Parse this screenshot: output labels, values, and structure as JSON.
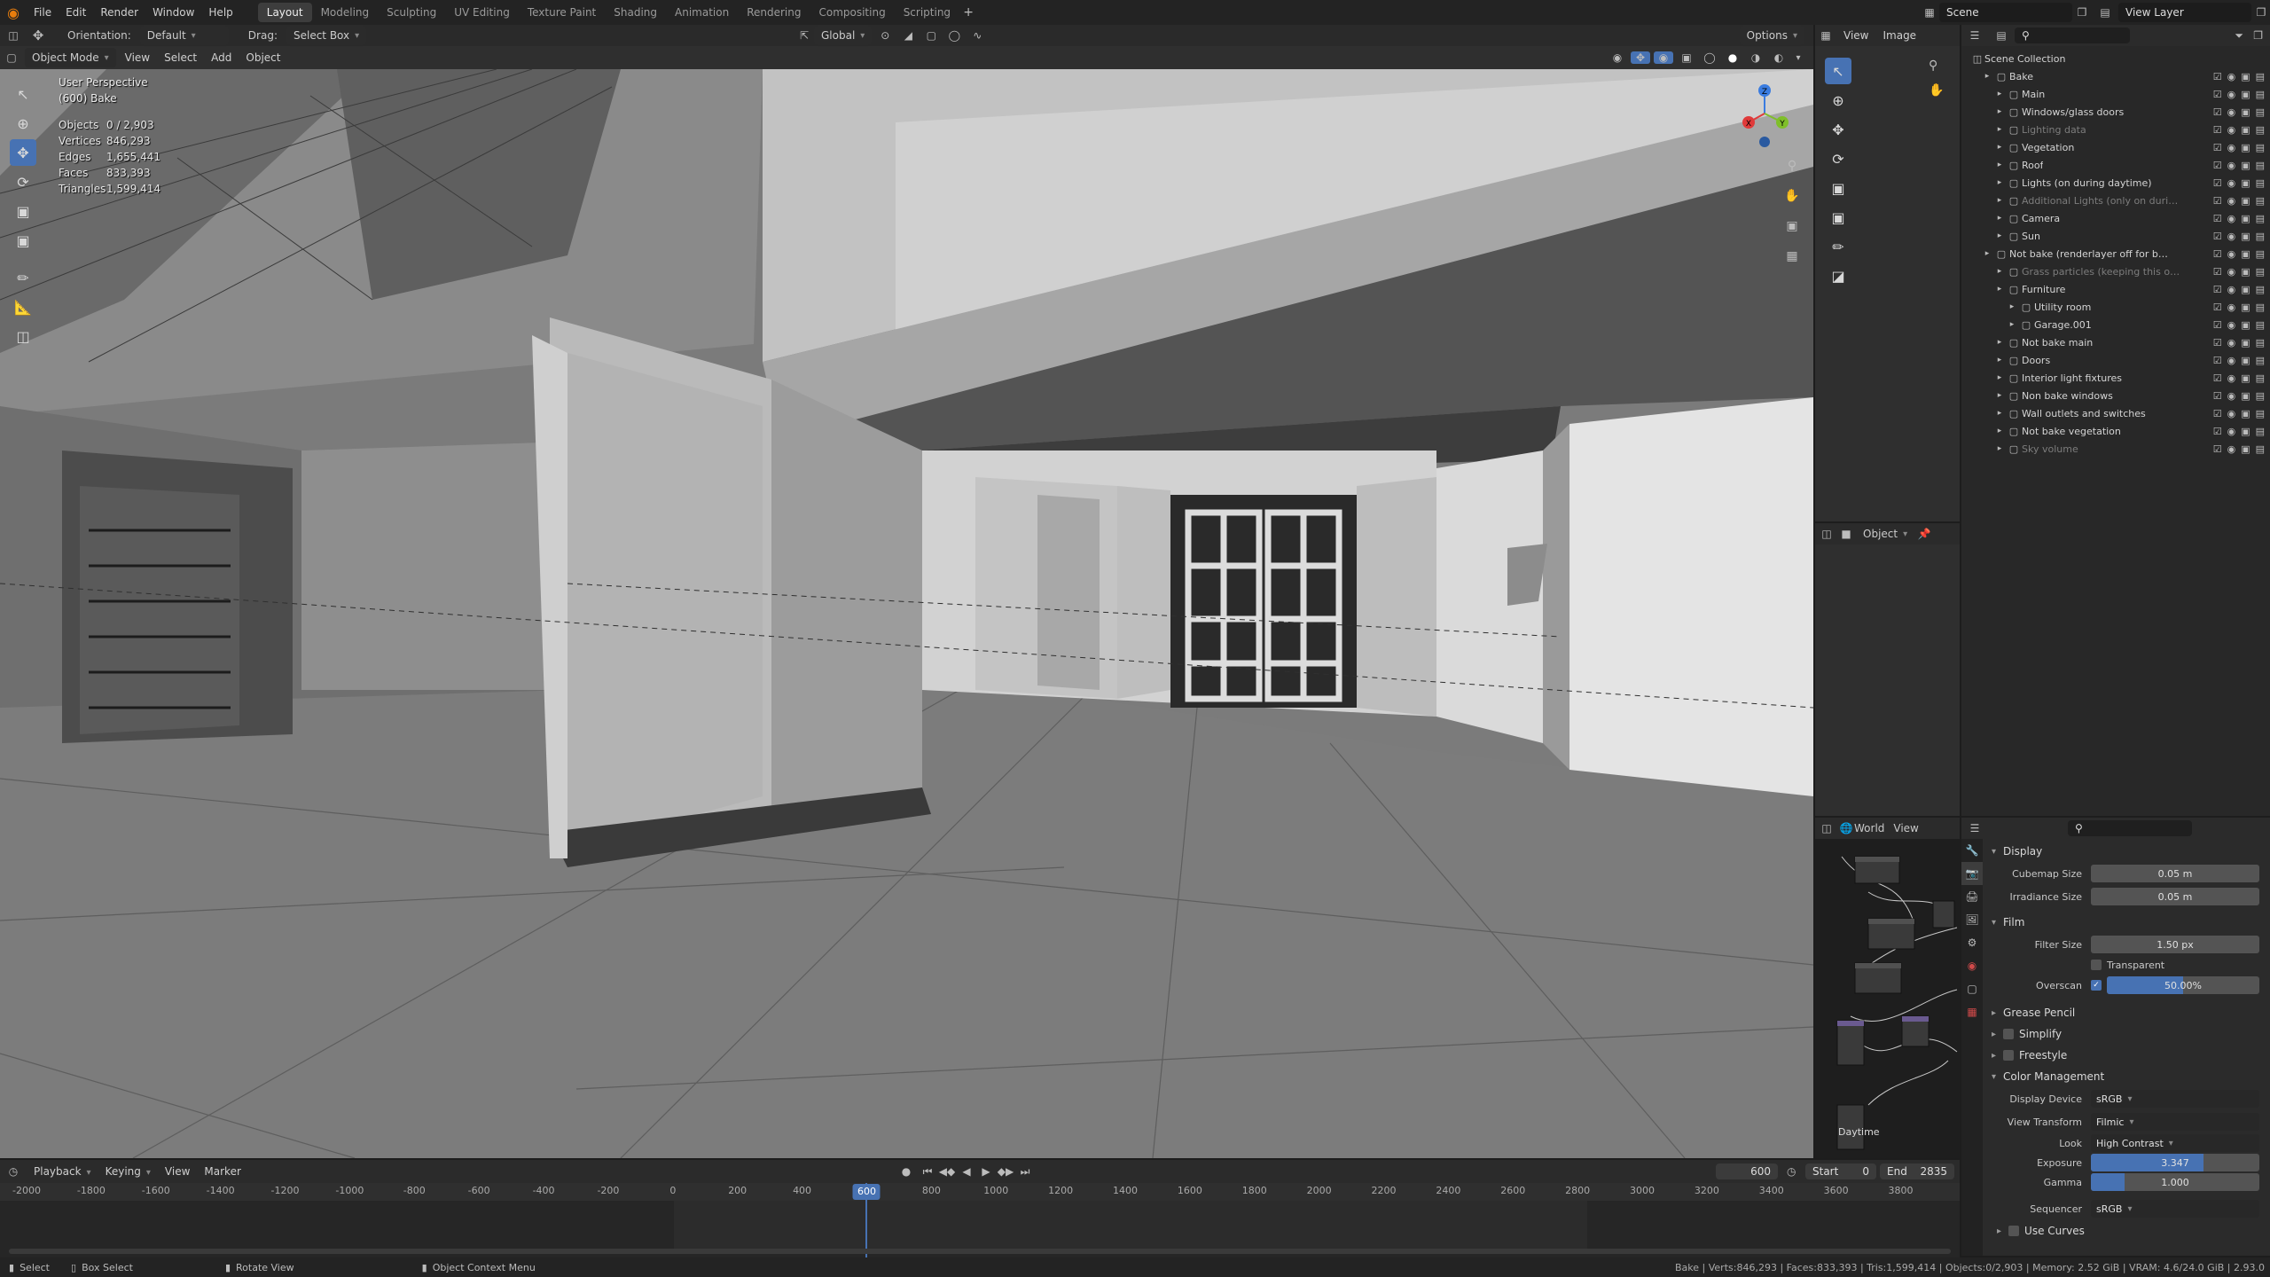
{
  "topbar": {
    "menus": [
      "File",
      "Edit",
      "Render",
      "Window",
      "Help"
    ],
    "workspaces": [
      "Layout",
      "Modeling",
      "Sculpting",
      "UV Editing",
      "Texture Paint",
      "Shading",
      "Animation",
      "Rendering",
      "Compositing",
      "Scripting"
    ],
    "active_workspace": "Layout",
    "scene": "Scene",
    "view_layer": "View Layer"
  },
  "tool_header": {
    "orientation_label": "Orientation:",
    "orientation_value": "Default",
    "drag_label": "Drag:",
    "drag_value": "Select Box",
    "transform_space": "Global",
    "options": "Options"
  },
  "viewport_header": {
    "mode": "Object Mode",
    "menus": [
      "View",
      "Select",
      "Add",
      "Object"
    ]
  },
  "viewport": {
    "view_name": "User Perspective",
    "collection": "(600) Bake",
    "stats": [
      {
        "label": "Objects",
        "value": "0 / 2,903"
      },
      {
        "label": "Vertices",
        "value": "846,293"
      },
      {
        "label": "Edges",
        "value": "1,655,441"
      },
      {
        "label": "Faces",
        "value": "833,393"
      },
      {
        "label": "Triangles",
        "value": "1,599,414"
      }
    ],
    "gizmo": {
      "x": "X",
      "y": "Y",
      "z": "Z"
    }
  },
  "image_editor_header": {
    "menus": [
      "View",
      "Image"
    ]
  },
  "outliner": {
    "root": "Scene Collection",
    "items": [
      {
        "label": "Bake",
        "depth": 0,
        "dim": false
      },
      {
        "label": "Main",
        "depth": 1,
        "dim": false
      },
      {
        "label": "Windows/glass doors",
        "depth": 1,
        "dim": false
      },
      {
        "label": "Lighting data",
        "depth": 1,
        "dim": true
      },
      {
        "label": "Vegetation",
        "depth": 1,
        "dim": false
      },
      {
        "label": "Roof",
        "depth": 1,
        "dim": false
      },
      {
        "label": "Lights (on during daytime)",
        "depth": 1,
        "dim": false
      },
      {
        "label": "Additional Lights (only on during ni",
        "depth": 1,
        "dim": true
      },
      {
        "label": "Camera",
        "depth": 1,
        "dim": false
      },
      {
        "label": "Sun",
        "depth": 1,
        "dim": false
      },
      {
        "label": "Not bake (renderlayer off for baking)",
        "depth": 0,
        "dim": false
      },
      {
        "label": "Grass particles (keeping this off in",
        "depth": 1,
        "dim": true
      },
      {
        "label": "Furniture",
        "depth": 1,
        "dim": false
      },
      {
        "label": "Utility room",
        "depth": 2,
        "dim": false
      },
      {
        "label": "Garage.001",
        "depth": 2,
        "dim": false
      },
      {
        "label": "Not bake main",
        "depth": 1,
        "dim": false
      },
      {
        "label": "Doors",
        "depth": 1,
        "dim": false
      },
      {
        "label": "Interior light fixtures",
        "depth": 1,
        "dim": false
      },
      {
        "label": "Non bake windows",
        "depth": 1,
        "dim": false
      },
      {
        "label": "Wall outlets and switches",
        "depth": 1,
        "dim": false
      },
      {
        "label": "Not bake vegetation",
        "depth": 1,
        "dim": false
      },
      {
        "label": "Sky volume",
        "depth": 1,
        "dim": true
      }
    ]
  },
  "mid_panel": {
    "header": "Object"
  },
  "node_editor": {
    "world": "World",
    "view": "View",
    "node_label": "Daytime"
  },
  "properties": {
    "display_section": "Display",
    "cubemap_label": "Cubemap Size",
    "cubemap_value": "0.05 m",
    "irradiance_label": "Irradiance Size",
    "irradiance_value": "0.05 m",
    "film_section": "Film",
    "filter_label": "Filter Size",
    "filter_value": "1.50 px",
    "transparent_label": "Transparent",
    "overscan_label": "Overscan",
    "overscan_value": "50.00%",
    "overscan_fraction": 0.5,
    "grease_pencil": "Grease Pencil",
    "simplify": "Simplify",
    "freestyle": "Freestyle",
    "color_mgmt": "Color Management",
    "display_device_label": "Display Device",
    "display_device_value": "sRGB",
    "view_transform_label": "View Transform",
    "view_transform_value": "Filmic",
    "look_label": "Look",
    "look_value": "High Contrast",
    "exposure_label": "Exposure",
    "exposure_value": "3.347",
    "exposure_fraction": 0.67,
    "gamma_label": "Gamma",
    "gamma_value": "1.000",
    "gamma_fraction": 0.2,
    "sequencer_label": "Sequencer",
    "sequencer_value": "sRGB",
    "use_curves": "Use Curves"
  },
  "timeline": {
    "menus": [
      "Playback",
      "Keying",
      "View",
      "Marker"
    ],
    "current_frame": "600",
    "start_label": "Start",
    "start_value": "0",
    "end_label": "End",
    "end_value": "2835",
    "ticks": [
      "-2000",
      "-1800",
      "-1600",
      "-1400",
      "-1200",
      "-1000",
      "-800",
      "-600",
      "-400",
      "-200",
      "0",
      "200",
      "400",
      "600",
      "800",
      "1000",
      "1200",
      "1400",
      "1600",
      "1800",
      "2000",
      "2200",
      "2400",
      "2600",
      "2800",
      "3000",
      "3200",
      "3400",
      "3600",
      "3800"
    ],
    "playhead": "600"
  },
  "statusbar": {
    "select": "Select",
    "box_select": "Box Select",
    "rotate_view": "Rotate View",
    "context_menu": "Object Context Menu",
    "info": "Bake | Verts:846,293 | Faces:833,393 | Tris:1,599,414 | Objects:0/2,903 | Memory: 2.52 GiB | VRAM: 4.6/24.0 GiB | 2.93.0"
  }
}
